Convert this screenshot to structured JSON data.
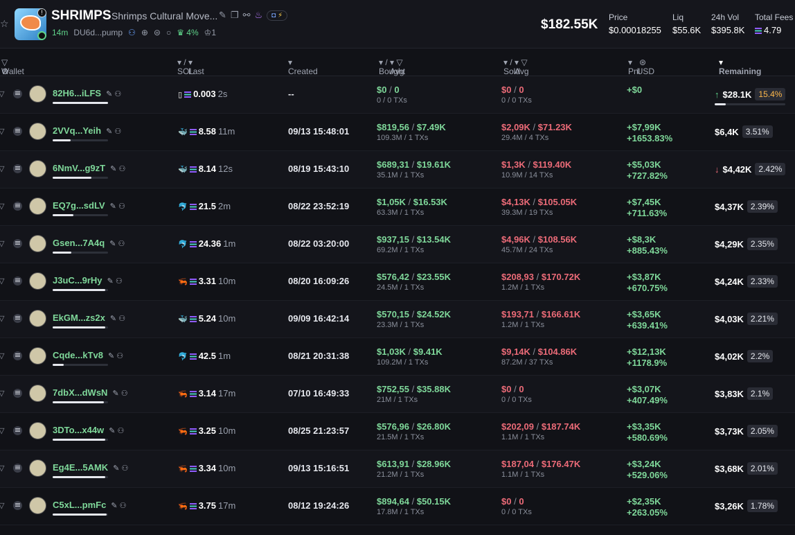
{
  "token": {
    "ticker": "SHRIMPS",
    "name": "Shrimps Cultural Move...",
    "age": "14m",
    "address": "DU6d...pump",
    "holders_pct": "4%",
    "crown_count": "1",
    "market_cap": "$182.55K",
    "stats": [
      {
        "label": "Price",
        "value": "$0.00018255"
      },
      {
        "label": "Liq",
        "value": "$55.6K"
      },
      {
        "label": "24h Vol",
        "value": "$395.8K"
      },
      {
        "label": "Total Fees",
        "value": "4.79"
      }
    ]
  },
  "columns": {
    "wallet": "Wallet",
    "sol_bal": "SOL Bal",
    "last_active": "Last Active",
    "created": "Created",
    "bought": "Bought",
    "avg_mc_b": "Avg MC",
    "sold": "Sold",
    "avg_mc_s": "Avg MC",
    "pnl": "Pnl",
    "usd": "USD",
    "remaining": "Remaining"
  },
  "rows": [
    {
      "wallet": "82H6...iLFS",
      "sol": "0.003",
      "active": "2s",
      "created": "--",
      "bought": "$0",
      "bought_mc": "0",
      "bought_sub": "0 / 0 TXs",
      "sold": "$0",
      "sold_mc": "0",
      "sold_sub": "0 / 0 TXs",
      "pnl": "+$0",
      "pnl_pct": "",
      "remaining": "$28.1K",
      "rem_pct": "15.4%",
      "arrow": "up",
      "bar": 1.0
    },
    {
      "wallet": "2VVq...Yeih",
      "sol": "8.58",
      "active": "11m",
      "created": "09/13 15:48:01",
      "bought": "$819,56",
      "bought_mc": "$7.49K",
      "bought_sub": "109.3M / 1 TXs",
      "sold": "$2,09K",
      "sold_mc": "$71.23K",
      "sold_sub": "29.4M / 4 TXs",
      "pnl": "+$7,99K",
      "pnl_pct": "+1653.83%",
      "remaining": "$6,4K",
      "rem_pct": "3.51%",
      "arrow": "",
      "bar": 0.33
    },
    {
      "wallet": "6NmV...g9zT",
      "sol": "8.14",
      "active": "12s",
      "created": "08/19 15:43:10",
      "bought": "$689,31",
      "bought_mc": "$19.61K",
      "bought_sub": "35.1M / 1 TXs",
      "sold": "$1,3K",
      "sold_mc": "$119.40K",
      "sold_sub": "10.9M / 14 TXs",
      "pnl": "+$5,03K",
      "pnl_pct": "+727.82%",
      "remaining": "$4,42K",
      "rem_pct": "2.42%",
      "arrow": "down",
      "bar": 0.7
    },
    {
      "wallet": "EQ7g...sdLV",
      "sol": "21.5",
      "active": "2m",
      "created": "08/22 23:52:19",
      "bought": "$1,05K",
      "bought_mc": "$16.53K",
      "bought_sub": "63.3M / 1 TXs",
      "sold": "$4,13K",
      "sold_mc": "$105.05K",
      "sold_sub": "39.3M / 19 TXs",
      "pnl": "+$7,45K",
      "pnl_pct": "+711.63%",
      "remaining": "$4,37K",
      "rem_pct": "2.39%",
      "arrow": "",
      "bar": 0.38
    },
    {
      "wallet": "Gsen...7A4q",
      "sol": "24.36",
      "active": "1m",
      "created": "08/22 03:20:00",
      "bought": "$937,15",
      "bought_mc": "$13.54K",
      "bought_sub": "69.2M / 1 TXs",
      "sold": "$4,96K",
      "sold_mc": "$108.56K",
      "sold_sub": "45.7M / 24 TXs",
      "pnl": "+$8,3K",
      "pnl_pct": "+885.43%",
      "remaining": "$4,29K",
      "rem_pct": "2.35%",
      "arrow": "",
      "bar": 0.34
    },
    {
      "wallet": "J3uC...9rHy",
      "sol": "3.31",
      "active": "10m",
      "created": "08/20 16:09:26",
      "bought": "$576,42",
      "bought_mc": "$23.55K",
      "bought_sub": "24.5M / 1 TXs",
      "sold": "$208,93",
      "sold_mc": "$170.72K",
      "sold_sub": "1.2M / 1 TXs",
      "pnl": "+$3,87K",
      "pnl_pct": "+670.75%",
      "remaining": "$4,24K",
      "rem_pct": "2.33%",
      "arrow": "",
      "bar": 0.95
    },
    {
      "wallet": "EkGM...zs2x",
      "sol": "5.24",
      "active": "10m",
      "created": "09/09 16:42:14",
      "bought": "$570,15",
      "bought_mc": "$24.52K",
      "bought_sub": "23.3M / 1 TXs",
      "sold": "$193,71",
      "sold_mc": "$166.61K",
      "sold_sub": "1.2M / 1 TXs",
      "pnl": "+$3,65K",
      "pnl_pct": "+639.41%",
      "remaining": "$4,03K",
      "rem_pct": "2.21%",
      "arrow": "",
      "bar": 0.95
    },
    {
      "wallet": "Cqde...kTv8",
      "sol": "42.5",
      "active": "1m",
      "created": "08/21 20:31:38",
      "bought": "$1,03K",
      "bought_mc": "$9.41K",
      "bought_sub": "109.2M / 1 TXs",
      "sold": "$9,14K",
      "sold_mc": "$104.86K",
      "sold_sub": "87.2M / 37 TXs",
      "pnl": "+$12,13K",
      "pnl_pct": "+1178.9%",
      "remaining": "$4,02K",
      "rem_pct": "2.2%",
      "arrow": "",
      "bar": 0.2
    },
    {
      "wallet": "7dbX...dWsN",
      "sol": "3.14",
      "active": "17m",
      "created": "07/10 16:49:33",
      "bought": "$752,55",
      "bought_mc": "$35.88K",
      "bought_sub": "21M / 1 TXs",
      "sold": "$0",
      "sold_mc": "0",
      "sold_sub": "0 / 0 TXs",
      "pnl": "+$3,07K",
      "pnl_pct": "+407.49%",
      "remaining": "$3,83K",
      "rem_pct": "2.1%",
      "arrow": "",
      "bar": 0.93
    },
    {
      "wallet": "3DTo...x44w",
      "sol": "3.25",
      "active": "10m",
      "created": "08/25 21:23:57",
      "bought": "$576,96",
      "bought_mc": "$26.80K",
      "bought_sub": "21.5M / 1 TXs",
      "sold": "$202,09",
      "sold_mc": "$187.74K",
      "sold_sub": "1.1M / 1 TXs",
      "pnl": "+$3,35K",
      "pnl_pct": "+580.69%",
      "remaining": "$3,73K",
      "rem_pct": "2.05%",
      "arrow": "",
      "bar": 0.95
    },
    {
      "wallet": "Eg4E...5AMK",
      "sol": "3.34",
      "active": "10m",
      "created": "09/13 15:16:51",
      "bought": "$613,91",
      "bought_mc": "$28.96K",
      "bought_sub": "21.2M / 1 TXs",
      "sold": "$187,04",
      "sold_mc": "$176.47K",
      "sold_sub": "1.1M / 1 TXs",
      "pnl": "+$3,24K",
      "pnl_pct": "+529.06%",
      "remaining": "$3,68K",
      "rem_pct": "2.01%",
      "arrow": "",
      "bar": 0.95
    },
    {
      "wallet": "C5xL...pmFc",
      "sol": "3.75",
      "active": "17m",
      "created": "08/12 19:24:26",
      "bought": "$894,64",
      "bought_mc": "$50.15K",
      "bought_sub": "17.8M / 1 TXs",
      "sold": "$0",
      "sold_mc": "0",
      "sold_sub": "0 / 0 TXs",
      "pnl": "+$2,35K",
      "pnl_pct": "+263.05%",
      "remaining": "$3,26K",
      "rem_pct": "1.78%",
      "arrow": "",
      "bar": 0.98
    }
  ]
}
